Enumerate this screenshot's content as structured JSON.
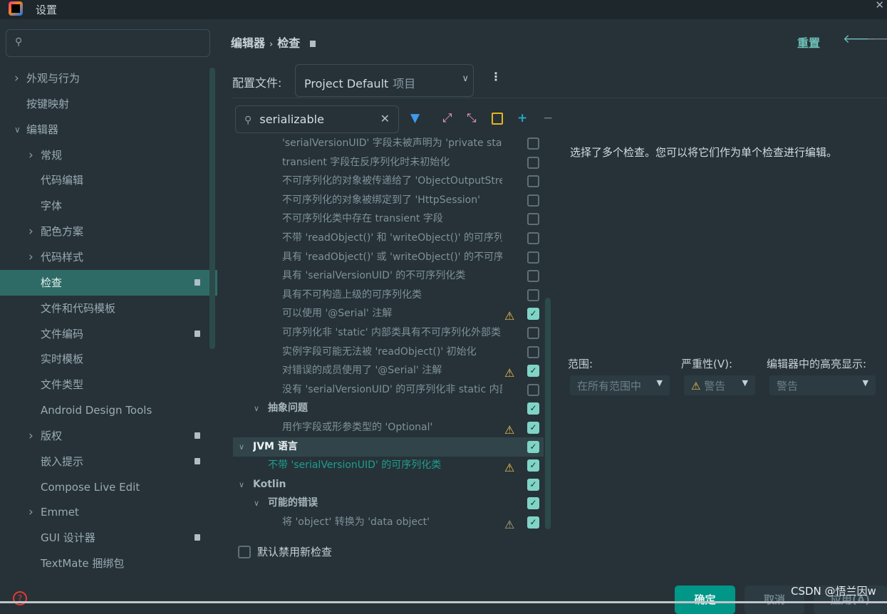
{
  "window": {
    "title": "设置",
    "close_icon": "close-icon"
  },
  "sidebar": {
    "search_placeholder": "",
    "items": [
      {
        "label": "外观与行为",
        "level": 0,
        "chevron": "right"
      },
      {
        "label": "按键映射",
        "level": 0
      },
      {
        "label": "编辑器",
        "level": 0,
        "chevron": "down"
      },
      {
        "label": "常规",
        "level": 1,
        "chevron": "right"
      },
      {
        "label": "代码编辑",
        "level": 1
      },
      {
        "label": "字体",
        "level": 1
      },
      {
        "label": "配色方案",
        "level": 1,
        "chevron": "right"
      },
      {
        "label": "代码样式",
        "level": 1,
        "chevron": "right"
      },
      {
        "label": "检查",
        "level": 1,
        "selected": true,
        "badge": true
      },
      {
        "label": "文件和代码模板",
        "level": 1
      },
      {
        "label": "文件编码",
        "level": 1,
        "badge": true
      },
      {
        "label": "实时模板",
        "level": 1
      },
      {
        "label": "文件类型",
        "level": 1
      },
      {
        "label": "Android Design Tools",
        "level": 1
      },
      {
        "label": "版权",
        "level": 1,
        "chevron": "right",
        "badge": true
      },
      {
        "label": "嵌入提示",
        "level": 1,
        "badge": true
      },
      {
        "label": "Compose Live Edit",
        "level": 1
      },
      {
        "label": "Emmet",
        "level": 1,
        "chevron": "right"
      },
      {
        "label": "GUI 设计器",
        "level": 1,
        "badge": true
      },
      {
        "label": "TextMate 捆绑包",
        "level": 1
      }
    ]
  },
  "header": {
    "breadcrumb": [
      "编辑器",
      "检查"
    ],
    "reset_label": "重置"
  },
  "profile": {
    "label": "配置文件:",
    "value": "Project Default",
    "scope": "项目"
  },
  "tree_search": {
    "value": "serializable"
  },
  "tree": [
    {
      "text": "'serialVersionUID' 字段未被声明为 'private static final long'",
      "level": 2,
      "checked": false
    },
    {
      "text": "transient 字段在反序列化时未初始化",
      "level": 2,
      "checked": false
    },
    {
      "text": "不可序列化的对象被传递给了 'ObjectOutputStream'",
      "level": 2,
      "checked": false
    },
    {
      "text": "不可序列化的对象被绑定到了 'HttpSession'",
      "level": 2,
      "checked": false
    },
    {
      "text": "不可序列化类中存在 transient 字段",
      "level": 2,
      "checked": false
    },
    {
      "text": "不带 'readObject()' 和 'writeObject()' 的可序列化类",
      "level": 2,
      "checked": false
    },
    {
      "text": "具有 'readObject()' 或 'writeObject()' 的不可序列化类",
      "level": 2,
      "checked": false
    },
    {
      "text": "具有 'serialVersionUID' 的不可序列化类",
      "level": 2,
      "checked": false
    },
    {
      "text": "具有不可构造上级的可序列化类",
      "level": 2,
      "checked": false
    },
    {
      "text": "可以使用 '@Serial' 注解",
      "level": 2,
      "checked": true,
      "warning": true
    },
    {
      "text": "可序列化非 'static' 内部类具有不可序列化外部类",
      "level": 2,
      "checked": false
    },
    {
      "text": "实例字段可能无法被 'readObject()' 初始化",
      "level": 2,
      "checked": false
    },
    {
      "text": "对错误的成员使用了 '@Serial' 注解",
      "level": 2,
      "checked": true,
      "warning": true
    },
    {
      "text": "没有 'serialVersionUID' 的可序列化非 static 内部类",
      "level": 2,
      "checked": false
    },
    {
      "text": "抽象问题",
      "level": 1,
      "group": true,
      "checked": true
    },
    {
      "text": "用作字段或形参类型的 'Optional'",
      "level": 2,
      "checked": true,
      "warning": true
    },
    {
      "text": "JVM 语言",
      "level": 0,
      "group": true,
      "checked": true,
      "selected": true
    },
    {
      "text": "不带 'serialVersionUID' 的可序列化类",
      "level": 1,
      "checked": true,
      "warning": true,
      "highlight": true
    },
    {
      "text": "Kotlin",
      "level": 0,
      "group": true,
      "checked": true
    },
    {
      "text": "可能的错误",
      "level": 1,
      "group": true,
      "checked": true
    },
    {
      "text": "将 'object' 转换为 'data object'",
      "level": 2,
      "checked": true,
      "warning": true,
      "warning_dim": true
    }
  ],
  "details": {
    "description": "选择了多个检查。您可以将它们作为单个检查进行编辑。",
    "scope_label": "范围:",
    "scope_value": "在所有范围中",
    "severity_label": "严重性(V):",
    "severity_value": "警告",
    "highlight_label": "编辑器中的高亮显示:",
    "highlight_value": "警告"
  },
  "disable_new": {
    "label": "默认禁用新检查",
    "checked": false
  },
  "buttons": {
    "ok": "确定",
    "cancel": "取消",
    "apply": "应用(A)"
  },
  "watermark": "CSDN @悟兰因w",
  "colors": {
    "accent": "#009688",
    "selected": "#2f6b66",
    "background": "#263238",
    "warning": "#f2c14e"
  }
}
